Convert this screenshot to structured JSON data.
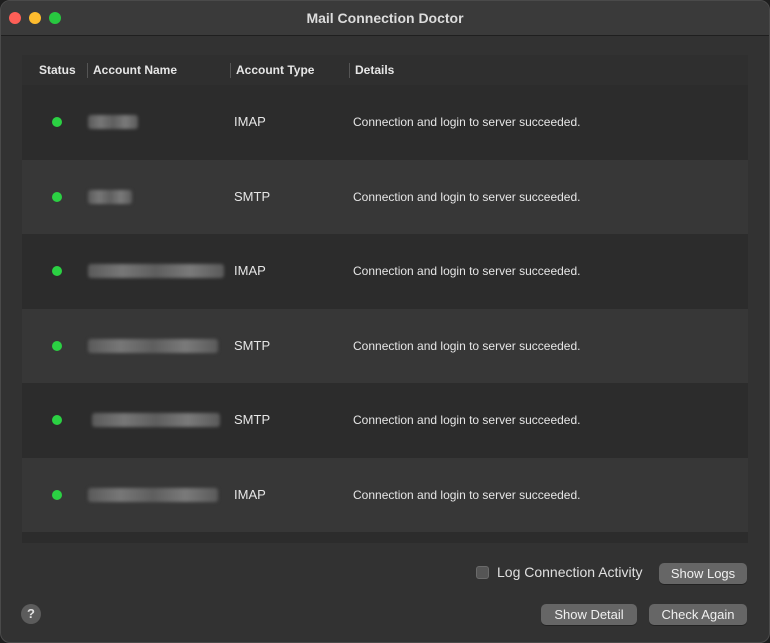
{
  "window": {
    "title": "Mail Connection Doctor"
  },
  "table": {
    "columns": [
      "Status",
      "Account Name",
      "Account Type",
      "Details"
    ],
    "rows": [
      {
        "status": "ok",
        "account_type": "IMAP",
        "details": "Connection and login to server succeeded."
      },
      {
        "status": "ok",
        "account_type": "SMTP",
        "details": "Connection and login to server succeeded."
      },
      {
        "status": "ok",
        "account_type": "IMAP",
        "details": "Connection and login to server succeeded."
      },
      {
        "status": "ok",
        "account_type": "SMTP",
        "details": "Connection and login to server succeeded."
      },
      {
        "status": "ok",
        "account_type": "SMTP",
        "details": "Connection and login to server succeeded."
      },
      {
        "status": "ok",
        "account_type": "IMAP",
        "details": "Connection and login to server succeeded."
      }
    ]
  },
  "footer": {
    "log_activity_label": "Log Connection Activity",
    "show_logs_label": "Show Logs",
    "show_detail_label": "Show Detail",
    "check_again_label": "Check Again",
    "help_label": "?"
  },
  "colors": {
    "status_ok": "#2bd143",
    "close": "#fe5f57",
    "minimize": "#febc2e",
    "maximize": "#28c840"
  }
}
